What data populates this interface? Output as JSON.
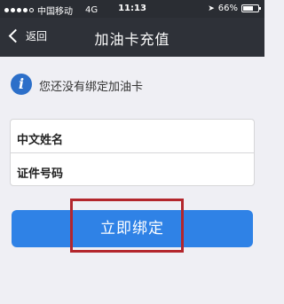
{
  "status_bar": {
    "carrier": "中国移动",
    "network": "4G",
    "time": "11:13",
    "battery": "66%",
    "battery_level": 0.66
  },
  "nav": {
    "back_label": "返回",
    "title": "加油卡充值"
  },
  "notice": {
    "icon": "info-icon",
    "text": "您还没有绑定加油卡"
  },
  "form": {
    "name_label": "中文姓名",
    "id_label": "证件号码"
  },
  "bind_button": {
    "label": "立即绑定",
    "color": "#2f82e6"
  },
  "colors": {
    "nav_bg": "#2e3138",
    "page_bg": "#efeff4",
    "highlight": "#b3262c"
  }
}
